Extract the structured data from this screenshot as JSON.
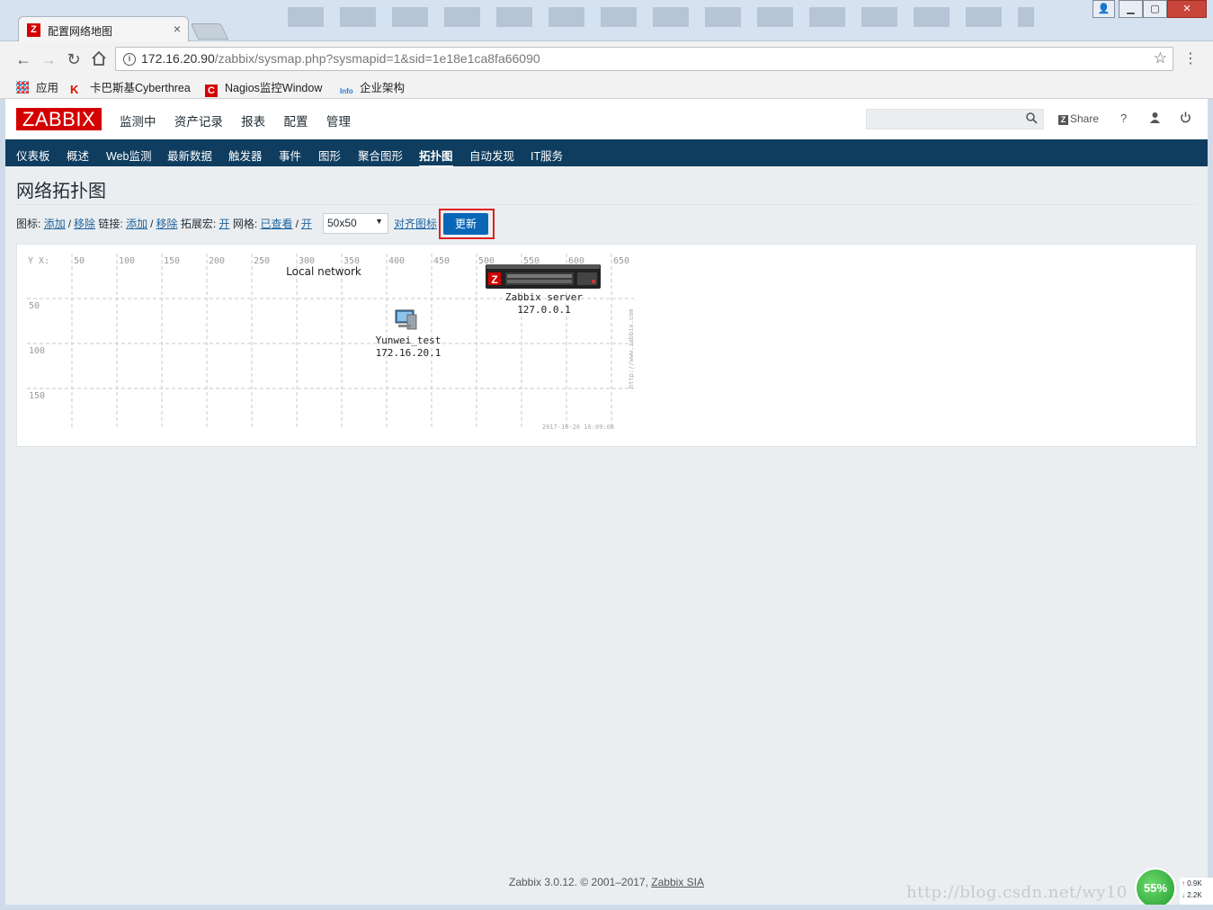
{
  "browser": {
    "tab_title": "配置网络地图",
    "tab_favicon": "Z",
    "url_host": "172.16.20.90",
    "url_path": "/zabbix/sysmap.php?sysmapid=1&sid=1e18e1ca8fa66090",
    "bookmarks": [
      {
        "label": "应用",
        "icon": "apps-grid-icon"
      },
      {
        "label": "卡巴斯基Cyberthrea",
        "icon": "kaspersky-icon"
      },
      {
        "label": "Nagios监控Window",
        "icon": "nagios-icon"
      },
      {
        "label": "企业架构",
        "icon": "info-icon"
      }
    ]
  },
  "header": {
    "logo": "ZABBIX",
    "top_menu": [
      "监测中",
      "资产记录",
      "报表",
      "配置",
      "管理"
    ],
    "active_top": "监测中",
    "share_label": "Share",
    "help_label": "?"
  },
  "sub_nav": [
    "仪表板",
    "概述",
    "Web监测",
    "最新数据",
    "触发器",
    "事件",
    "图形",
    "聚合图形",
    "拓扑图",
    "自动发现",
    "IT服务"
  ],
  "active_sub": "拓扑图",
  "page_title": "网络拓扑图",
  "controls": {
    "icon_label": "图标:",
    "add": "添加",
    "remove": "移除",
    "link_label": "链接:",
    "expand_label": "拓展宏:",
    "on": "开",
    "grid_label": "网格:",
    "shown": "已查看",
    "grid_size": "50x50",
    "align_icons": "对齐图标",
    "update": "更新"
  },
  "map": {
    "axis_label": "Y X:",
    "x_ticks": [
      "50",
      "100",
      "150",
      "200",
      "250",
      "300",
      "350",
      "400",
      "450",
      "500",
      "550",
      "600",
      "650"
    ],
    "y_ticks": [
      "50",
      "100",
      "150"
    ],
    "map_label": "Local network",
    "hosts": [
      {
        "name": "Zabbix server",
        "ip": "127.0.0.1",
        "icon": "server-rack-icon"
      },
      {
        "name": "Yunwei_test",
        "ip": "172.16.20.1",
        "icon": "workstation-icon"
      }
    ],
    "timestamp": "2017-10-26 16:09:08",
    "site_url": "http://www.zabbix.com"
  },
  "footer": {
    "text": "Zabbix 3.0.12. © 2001–2017,",
    "company": "Zabbix SIA"
  },
  "overlay": {
    "watermark": "http://blog.csdn.net/wy10",
    "gauge": "55%",
    "up": "0.9K",
    "down": "2.2K"
  }
}
